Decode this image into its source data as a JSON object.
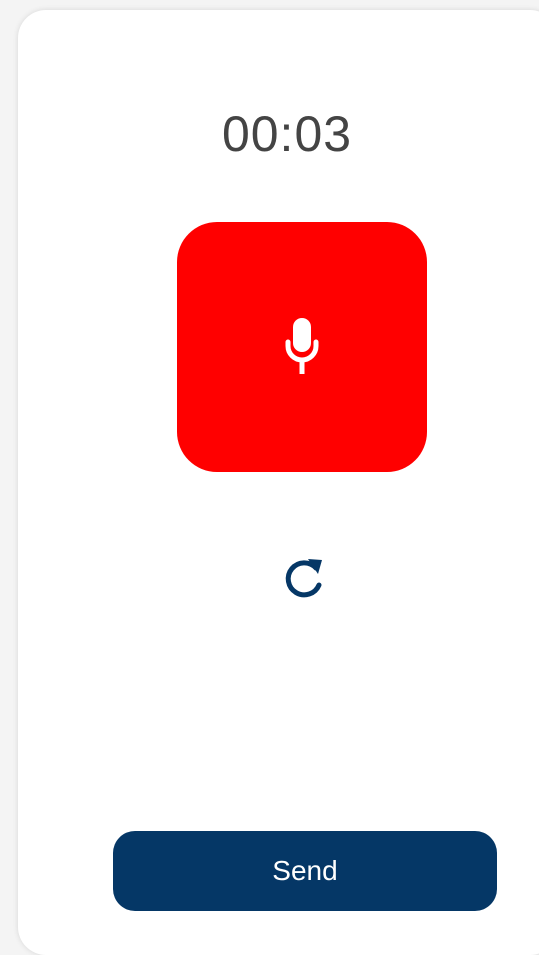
{
  "recorder": {
    "timer": "00:03",
    "record_icon": "microphone-icon",
    "reset_icon": "refresh-icon",
    "send_label": "Send"
  },
  "colors": {
    "record_button": "#ff0000",
    "accent": "#053766",
    "timer_text": "#444444",
    "background": "#ffffff"
  }
}
